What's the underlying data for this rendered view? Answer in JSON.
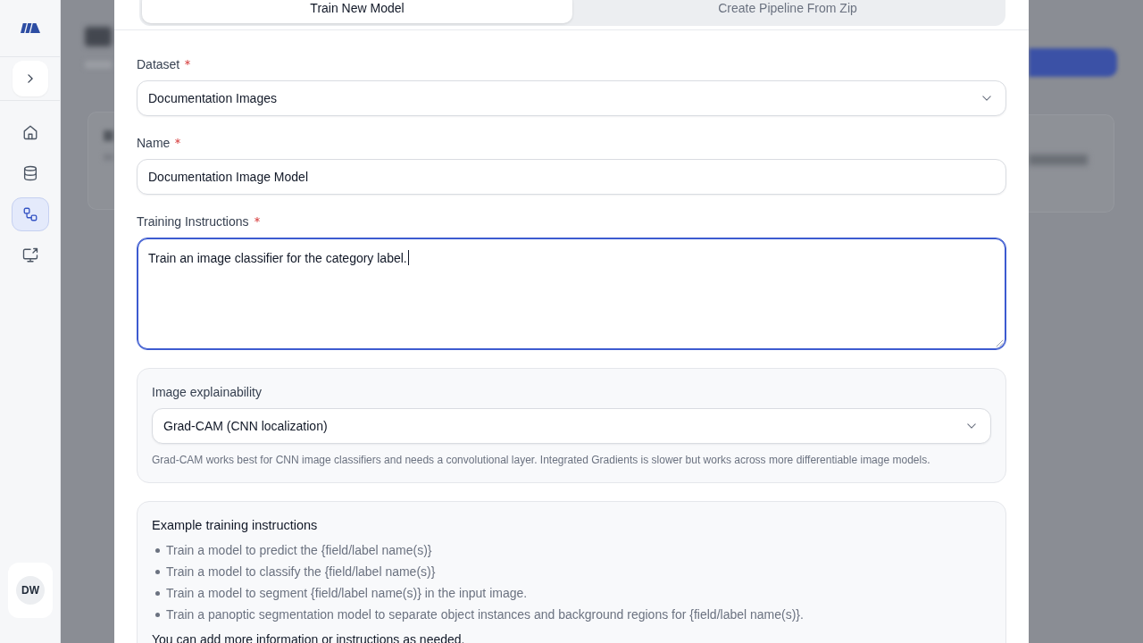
{
  "sidebar": {
    "nav_items": [
      {
        "selected": false
      },
      {
        "selected": false
      },
      {
        "selected": true
      },
      {
        "selected": false
      }
    ],
    "avatar": "DW"
  },
  "modal": {
    "tabs": [
      {
        "label": "Train New Model",
        "selected": true
      },
      {
        "label": "Create Pipeline From Zip",
        "selected": false
      }
    ],
    "fields": [
      {
        "kind": "select",
        "label": "Dataset",
        "required": true,
        "focused": false,
        "value": "Documentation Images"
      },
      {
        "kind": "text",
        "label": "Name",
        "required": true,
        "focused": false,
        "value": "Documentation Image Model"
      },
      {
        "kind": "textarea",
        "label": "Training Instructions",
        "required": true,
        "focused": true,
        "value": "Train an image classifier for the category label."
      }
    ],
    "explainability": {
      "label": "Image explainability",
      "value": "Grad-CAM (CNN localization)",
      "help": "Grad-CAM works best for CNN image classifiers and needs a convolutional layer. Integrated Gradients is slower but works across more differentiable image models."
    },
    "examples": {
      "title": "Example training instructions",
      "items": [
        "Train a model to predict the {field/label name(s)}",
        "Train a model to classify the {field/label name(s)}",
        "Train a model to segment {field/label name(s)} in the input image.",
        "Train a panoptic segmentation model to separate object instances and background regions for {field/label name(s)}."
      ],
      "note": "You can add more information or instructions as needed."
    }
  }
}
